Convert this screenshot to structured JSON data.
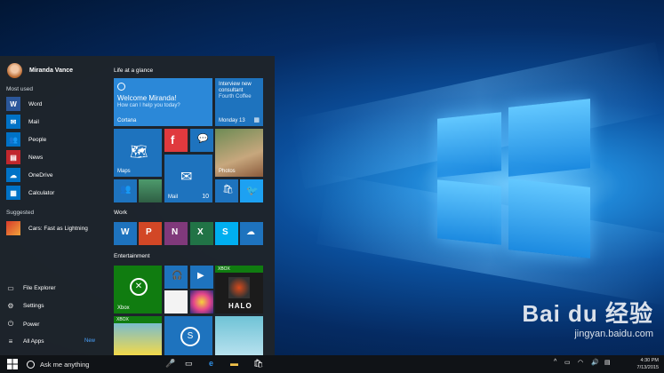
{
  "start_menu": {
    "user_name": "Miranda Vance",
    "most_used_label": "Most used",
    "most_used": [
      {
        "label": "Word",
        "icon": "word-icon",
        "color": "#2b579a"
      },
      {
        "label": "Mail",
        "icon": "mail-icon",
        "color": "#0072c6"
      },
      {
        "label": "People",
        "icon": "people-icon",
        "color": "#0072c6"
      },
      {
        "label": "News",
        "icon": "news-icon",
        "color": "#c1272d"
      },
      {
        "label": "OneDrive",
        "icon": "onedrive-icon",
        "color": "#0072c6"
      },
      {
        "label": "Calculator",
        "icon": "calculator-icon",
        "color": "#0072c6"
      }
    ],
    "suggested_label": "Suggested",
    "suggested_app": "Cars: Fast as Lightning",
    "system_items": [
      "File Explorer",
      "Settings",
      "Power",
      "All Apps"
    ],
    "all_apps_badge": "New",
    "groups": {
      "life": "Life at a glance",
      "work": "Work",
      "entertainment": "Entertainment"
    },
    "tiles": {
      "cortana_title": "Welcome Miranda!",
      "cortana_sub": "How can I help you today?",
      "cortana_label": "Cortana",
      "calendar_lines": [
        "Interview new",
        "consultant",
        "Fourth Coffee"
      ],
      "calendar_date": "Monday 13",
      "maps": "Maps",
      "photos": "Photos",
      "mail": "Mail",
      "mail_count": "10",
      "xbox": "Xbox",
      "xbox_badge": "XBOX",
      "halo_text": "HALO"
    }
  },
  "taskbar": {
    "search_placeholder": "Ask me anything",
    "time": "4:30 PM",
    "date": "7/13/2015"
  },
  "colors": {
    "accent": "#1e73be",
    "menu_bg": "#1e242a",
    "taskbar_bg": "#101317"
  }
}
